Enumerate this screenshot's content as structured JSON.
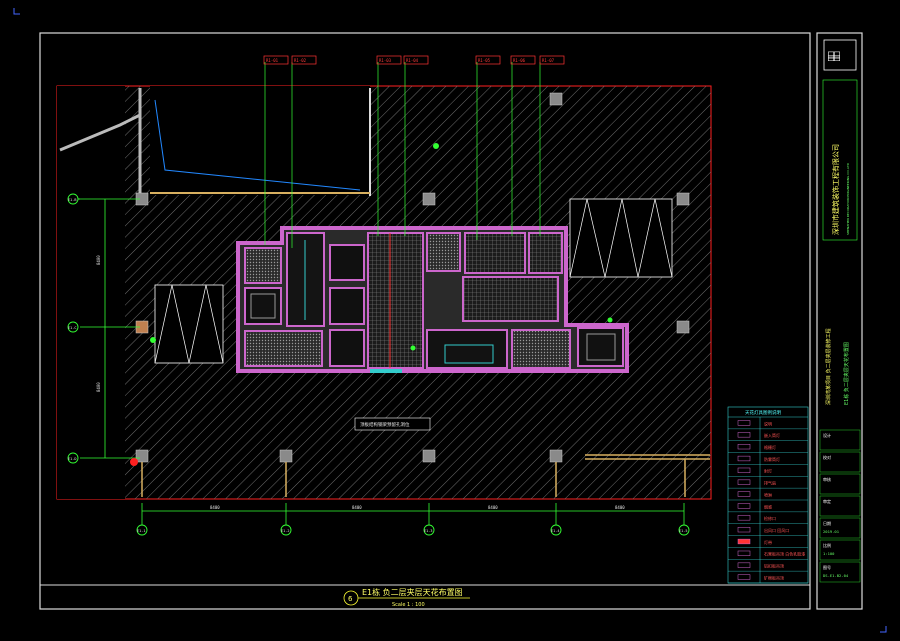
{
  "drawing": {
    "title": "E1栋 负二层夹层天花布置图",
    "scale": "Scale 1 : 100",
    "index_symbol": "6",
    "note_label": "顶板结构钢梁预留孔洞位",
    "callout_tags": [
      "R1-01",
      "R1-02",
      "R1-03",
      "R1-04",
      "R1-05",
      "R1-06",
      "R1-07"
    ],
    "grid_rows": [
      "E1-B",
      "E1-C",
      "E1-D"
    ],
    "grid_cols": [
      "E1-1",
      "E1-2",
      "E1-3",
      "E1-4",
      "E1-5"
    ],
    "dim_vertical": [
      "8400",
      "8400"
    ],
    "dim_horizontal": [
      "8400",
      "8400",
      "8400",
      "8400"
    ]
  },
  "legend": {
    "title": "天花灯具图例说明",
    "rows": [
      {
        "sym": "",
        "desc": "说明"
      },
      {
        "sym": "",
        "desc": "嵌入筒灯"
      },
      {
        "sym": "",
        "desc": "格栅灯"
      },
      {
        "sym": "",
        "desc": "防雾筒灯"
      },
      {
        "sym": "",
        "desc": "射灯"
      },
      {
        "sym": "",
        "desc": "排气扇"
      },
      {
        "sym": "",
        "desc": "喷淋"
      },
      {
        "sym": "",
        "desc": "烟感"
      },
      {
        "sym": "",
        "desc": "检修口"
      },
      {
        "sym": "",
        "desc": "出风口 回风口"
      },
      {
        "sym": "",
        "desc": "灯带"
      },
      {
        "sym": "",
        "desc": "石膏板吊顶 白色乳胶漆"
      },
      {
        "sym": "",
        "desc": "铝扣板吊顶"
      },
      {
        "sym": "",
        "desc": "矿棉板吊顶"
      }
    ]
  },
  "title_block": {
    "company": "深圳市建筑装饰工程有限公司",
    "company_en": "SHENZHEN DECORATION ENGINEERING CO.,LTD",
    "project": "深圳湾某项目 负二层夹层装修工程",
    "sheet_name": "E1栋 负二层夹层天花布置图",
    "fields": [
      "设计",
      "校对",
      "审核",
      "审定",
      "日期",
      "比例",
      "图号"
    ],
    "values": [
      "",
      "",
      "",
      "",
      "2019.01",
      "1:100",
      "DS-E1-B2-04"
    ]
  },
  "colors": {
    "border": "#ffffff",
    "column_red": "#ff2020",
    "room_magenta": "#cc66cc",
    "leader_green": "#33ff33",
    "hatch_gray": "#7a7a7a",
    "title_yellow": "#ffff33",
    "legend_cyan": "#33cccc"
  }
}
